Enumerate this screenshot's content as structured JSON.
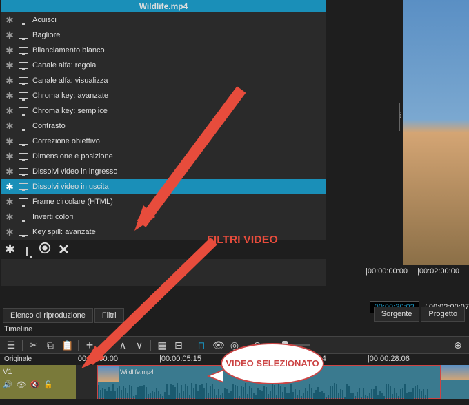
{
  "header_title": "Wildlife.mp4",
  "filters": [
    "Acuisci",
    "Bagliore",
    "Bilanciamento bianco",
    "Canale alfa: regola",
    "Canale alfa: visualizza",
    "Chroma key: avanzate",
    "Chroma key: semplice",
    "Contrasto",
    "Correzione obiettivo",
    "Dimensione e posizione",
    "Dissolvi video in ingresso",
    "Dissolvi video in uscita",
    "Frame circolare (HTML)",
    "Inverti colori",
    "Key spill: avanzate"
  ],
  "selected_filter_index": 11,
  "tabs_left": [
    "Elenco di riproduzione",
    "Filtri"
  ],
  "tabs_right": [
    "Sorgente",
    "Progetto"
  ],
  "timeline_label": "Timeline",
  "originale_label": "Originale",
  "track_label": "V1",
  "clip_name": "Wildlife.mp4",
  "ruler_top": [
    "|00:00:00:00",
    "|00:02:00:00"
  ],
  "time_current": "00:00:30:02",
  "time_total": "/ 00:02:00:07",
  "timeline_times": [
    "|00:00:00:00",
    "|00:00:05:15",
    "",
    "|00:00:22:14",
    "|00:00:28:06"
  ],
  "annotation_filters": "FILTRI VIDEO",
  "annotation_bubble": "VIDEO SELEZIONATO"
}
